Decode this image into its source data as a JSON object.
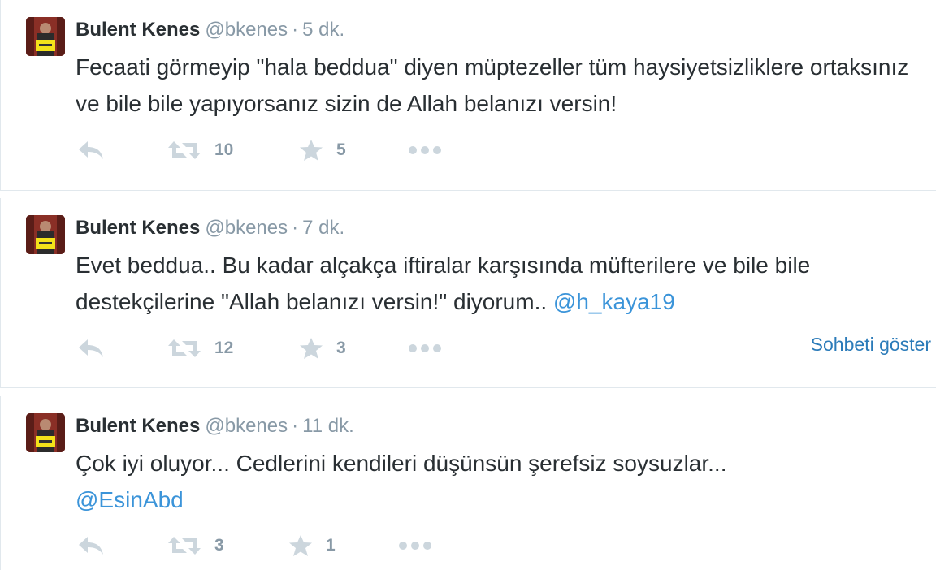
{
  "tweets": [
    {
      "author": "Bulent Kenes",
      "handle": "@bkenes",
      "separator": "·",
      "time": "5 dk.",
      "text": "Fecaati görmeyip \"hala beddua\" diyen müptezeller tüm haysiyetsizliklere ortaksınız ve bile bile yapıyorsanız sizin de Allah belanızı versin!",
      "mention": "",
      "retweets": "10",
      "favorites": "5",
      "conversation": ""
    },
    {
      "author": "Bulent Kenes",
      "handle": "@bkenes",
      "separator": "·",
      "time": "7 dk.",
      "text": "Evet beddua.. Bu kadar alçakça iftiralar karşısında müfterilere ve bile bile destekçilerine \"Allah belanızı versin!\" diyorum..",
      "mention": "@h_kaya19",
      "retweets": "12",
      "favorites": "3",
      "conversation": "Sohbeti göster"
    },
    {
      "author": "Bulent Kenes",
      "handle": "@bkenes",
      "separator": "·",
      "time": "11 dk.",
      "text": "Çok iyi  oluyor... Cedlerini kendileri düşünsün şerefsiz soysuzlar...",
      "mention": "@EsinAbd",
      "retweets": "3",
      "favorites": "1",
      "conversation": ""
    }
  ],
  "icons": {
    "reply": "reply-icon",
    "retweet": "retweet-icon",
    "favorite": "star-icon",
    "more": "more-icon"
  },
  "colors": {
    "text": "#292f33",
    "muted": "#8899a6",
    "icon": "#ccd6dd",
    "link": "#3b94d9",
    "border": "#e1e8ed"
  }
}
